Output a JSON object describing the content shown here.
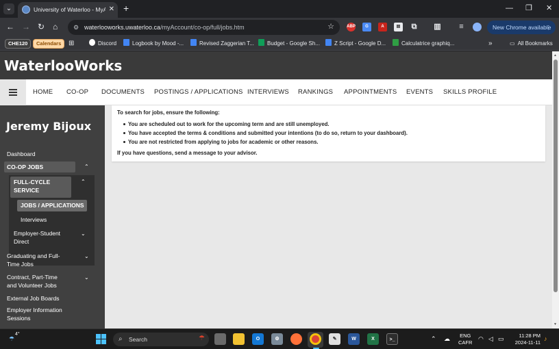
{
  "browser": {
    "tab": {
      "title": "University of Waterloo - MyAcc"
    },
    "url_host": "waterlooworks.uwaterloo.ca",
    "url_path": "/myAccount/co-op/full/jobs.htm",
    "update_button": "New Chrome available",
    "extensions": [
      "ABP",
      "translate",
      "PDF",
      "doc",
      "puzzle",
      "sidebar",
      "queue",
      "profile"
    ],
    "bookmarks": {
      "chips": [
        {
          "label": "CHE120",
          "color": "#3d3d3d",
          "text_color": "#ffffff"
        },
        {
          "label": "Calendars",
          "color": "#ffd9a8",
          "text_color": "#8a4b00"
        }
      ],
      "items": [
        {
          "label": "Discord",
          "icon": "discord-icon",
          "color": "#ffffff"
        },
        {
          "label": "Logbook by Mood -...",
          "icon": "google-docs-icon",
          "color": "#4285f4"
        },
        {
          "label": "Revised Zaggerian T...",
          "icon": "google-docs-icon",
          "color": "#4285f4"
        },
        {
          "label": "Budget - Google Sh...",
          "icon": "google-sheets-icon",
          "color": "#0f9d58"
        },
        {
          "label": "Z Script - Google D...",
          "icon": "google-docs-icon",
          "color": "#4285f4"
        },
        {
          "label": "Calculatrice graphiq...",
          "icon": "desmos-icon",
          "color": "#2f9e44"
        }
      ],
      "all_bookmarks": "All Bookmarks"
    }
  },
  "site": {
    "brand": "WaterlooWorks",
    "nav": [
      "HOME",
      "CO-OP",
      "DOCUMENTS",
      "POSTINGS / APPLICATIONS",
      "INTERVIEWS",
      "RANKINGS",
      "APPOINTMENTS",
      "EVENTS",
      "SKILLS PROFILE"
    ],
    "user_name": "Jeremy Bijoux",
    "sidebar": {
      "dashboard": "Dashboard",
      "coop_jobs": "CO-OP JOBS",
      "full_cycle_line1": "FULL-CYCLE",
      "full_cycle_line2": "SERVICE",
      "jobs_applications": "JOBS / APPLICATIONS",
      "interviews": "Interviews",
      "employer_direct_line1": "Employer-Student",
      "employer_direct_line2": "Direct",
      "graduating_line1": "Graduating and Full-",
      "graduating_line2": "Time Jobs",
      "contract_line1": "Contract, Part-Time",
      "contract_line2": "and Volunteer Jobs",
      "external": "External Job Boards",
      "employer_info_line1": "Employer Information",
      "employer_info_line2": "Sessions"
    },
    "notice": {
      "intro": "To search for jobs, ensure the following:",
      "bullets": [
        "You are scheduled out to work for the upcoming term and are still unemployed.",
        "You have accepted the terms & conditions and submitted your intentions (to do so, return to your dashboard).",
        "You are not restricted from applying to jobs for academic or other reasons."
      ],
      "footer": "If you have questions, send a message to your advisor."
    }
  },
  "taskbar": {
    "weather_temp": "4°",
    "search_label": "Search",
    "lang_line1": "ENG",
    "lang_line2": "CAFR",
    "time": "11:28 PM",
    "date": "2024-11-11",
    "apps": [
      {
        "name": "task-view",
        "color": "#6b6b6b",
        "glyph": ""
      },
      {
        "name": "file-explorer",
        "color": "#f2c232",
        "glyph": ""
      },
      {
        "name": "outlook",
        "color": "#1478d4",
        "glyph": "O"
      },
      {
        "name": "settings",
        "color": "#7a8a99",
        "glyph": "⚙"
      },
      {
        "name": "firefox",
        "color": "#ff7139",
        "glyph": ""
      },
      {
        "name": "chrome",
        "color": "#db4437",
        "glyph": ""
      },
      {
        "name": "notepad",
        "color": "#e0e0e0",
        "glyph": ""
      },
      {
        "name": "word",
        "color": "#2b579a",
        "glyph": "W"
      },
      {
        "name": "excel",
        "color": "#217346",
        "glyph": "X"
      },
      {
        "name": "terminal",
        "color": "#2d2d2d",
        "glyph": ">_"
      }
    ]
  }
}
